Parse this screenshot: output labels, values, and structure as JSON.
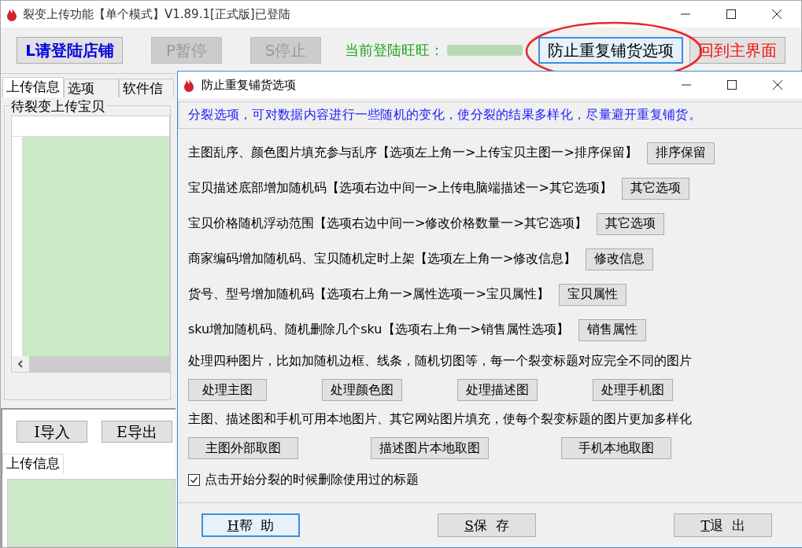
{
  "window": {
    "title": "裂变上传功能【单个模式】V1.89.1[正式版]已登陆"
  },
  "toolbar": {
    "buttons": [
      {
        "label": "L请登陆店铺",
        "kind": "login",
        "disabled": false
      },
      {
        "label": "P暂停",
        "kind": "normal",
        "disabled": true
      },
      {
        "label": "S停止",
        "kind": "normal",
        "disabled": true
      }
    ],
    "login_label": "当前登陆旺旺：",
    "right_buttons": [
      {
        "label": "防止重复铺货选项",
        "kind": "focused",
        "disabled": false
      },
      {
        "label": "回到主界面",
        "kind": "return",
        "disabled": false
      }
    ]
  },
  "tabs": [
    {
      "label": "上传信息",
      "selected": true
    },
    {
      "label": "选项",
      "selected": false
    },
    {
      "label": "软件信",
      "selected": false
    }
  ],
  "group": {
    "title": "待裂变上传宝贝"
  },
  "bottom_buttons": [
    "I导入",
    "E导出"
  ],
  "lower_tabs": [
    {
      "label": "上传信息",
      "selected": true
    }
  ],
  "dialog": {
    "title": "防止重复铺货选项",
    "intro": "分裂选项，可对数据内容进行一些随机的变化，使分裂的结果多样化，尽量避开重复铺货。",
    "options": [
      {
        "text": "主图乱序、颜色图片填充参与乱序【选项左上角一>上传宝贝主图一>排序保留】",
        "button": "排序保留"
      },
      {
        "text": "宝贝描述底部增加随机码【选项右边中间一>上传电脑端描述一>其它选项】",
        "button": "其它选项"
      },
      {
        "text": "宝贝价格随机浮动范围【选项右边中间一>修改价格数量一>其它选项】",
        "button": "其它选项"
      },
      {
        "text": "商家编码增加随机码、宝贝随机定时上架【选项左上角一>修改信息】",
        "button": "修改信息"
      },
      {
        "text": "货号、型号增加随机码【选项右上角一>属性选项一>宝贝属性】",
        "button": "宝贝属性"
      },
      {
        "text": "sku增加随机码、随机删除几个sku【选项右上角一>销售属性选项】",
        "button": "销售属性"
      }
    ],
    "sections": [
      {
        "text": "处理四种图片，比如加随机边框、线条，随机切图等，每一个裂变标题对应完全不同的图片",
        "buttons": [
          "处理主图",
          "处理颜色图",
          "处理描述图",
          "处理手机图"
        ]
      },
      {
        "text": "主图、描述图和手机可用本地图片、其它网站图片填充，使每个裂变标题的图片更加多样化",
        "buttons": [
          "主图外部取图",
          "描述图片本地取图",
          "手机本地取图"
        ]
      }
    ],
    "checkbox": {
      "label": "点击开始分裂的时候删除使用过的标题",
      "checked": true
    },
    "footer_buttons": [
      {
        "label": "H帮  助",
        "kind": "default"
      },
      {
        "label": "S保  存",
        "kind": "normal"
      },
      {
        "label": "T退  出",
        "kind": "normal"
      }
    ]
  }
}
